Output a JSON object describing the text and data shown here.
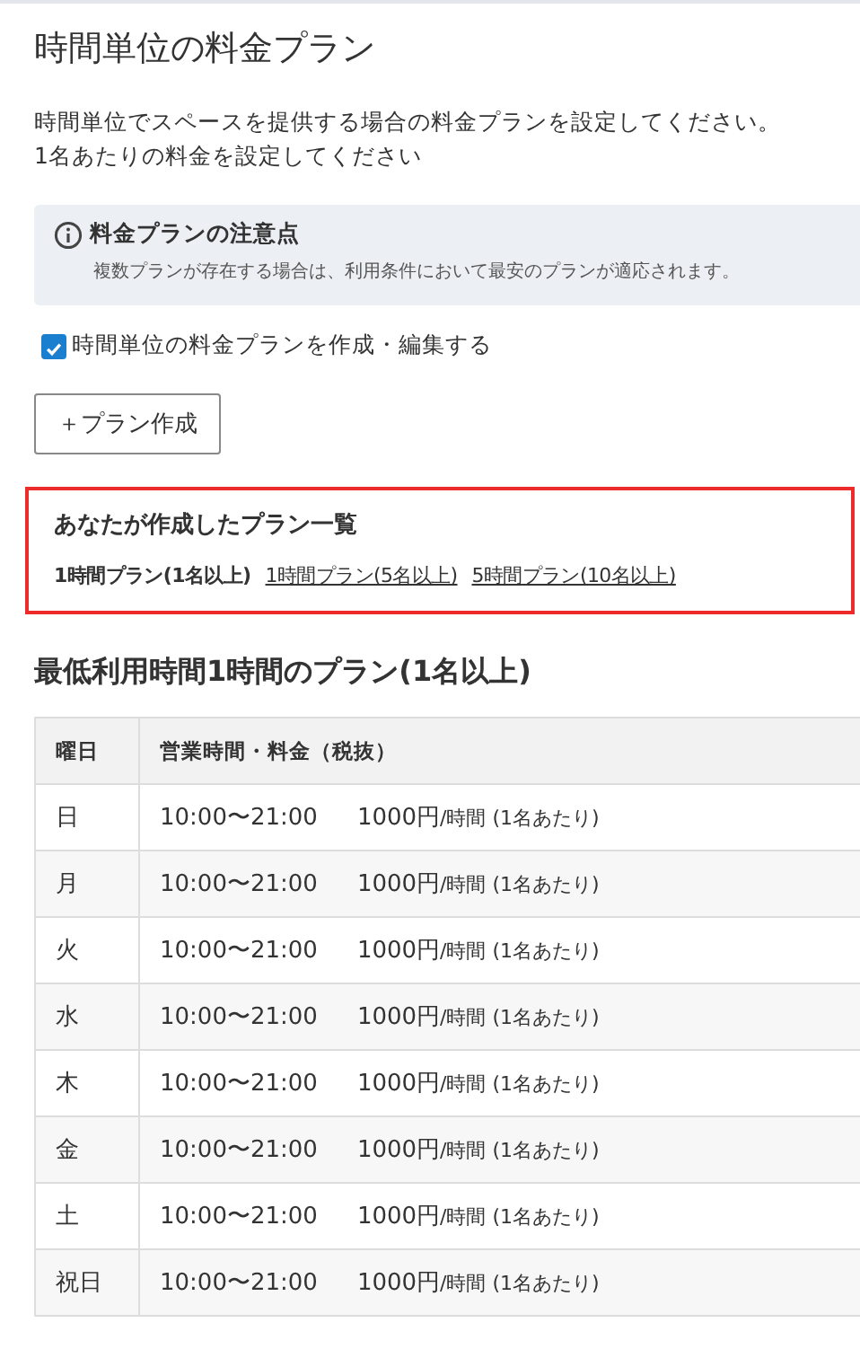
{
  "title": "時間単位の料金プラン",
  "description": [
    "時間単位でスペースを提供する場合の料金プランを設定してください。",
    "1名あたりの料金を設定してください"
  ],
  "notice": {
    "title": "料金プランの注意点",
    "text": "複数プランが存在する場合は、利用条件において最安のプランが適応されます。"
  },
  "checkbox": {
    "label": "時間単位の料金プランを作成・編集する",
    "checked": true
  },
  "create_button": "＋プラン作成",
  "plan_list": {
    "title": "あなたが作成したプラン一覧",
    "plans": [
      {
        "label": "1時間プラン(1名以上)",
        "selected": true
      },
      {
        "label": "1時間プラン(5名以上)",
        "selected": false
      },
      {
        "label": "5時間プラン(10名以上)",
        "selected": false
      }
    ]
  },
  "plan_title": "最低利用時間1時間のプラン(1名以上)",
  "table": {
    "columns": [
      "曜日",
      "営業時間・料金（税抜）"
    ],
    "rows": [
      {
        "day": "日",
        "hours": "10:00〜21:00",
        "price": "1000円",
        "unit": "/時間 (1名あたり)"
      },
      {
        "day": "月",
        "hours": "10:00〜21:00",
        "price": "1000円",
        "unit": "/時間 (1名あたり)"
      },
      {
        "day": "火",
        "hours": "10:00〜21:00",
        "price": "1000円",
        "unit": "/時間 (1名あたり)"
      },
      {
        "day": "水",
        "hours": "10:00〜21:00",
        "price": "1000円",
        "unit": "/時間 (1名あたり)"
      },
      {
        "day": "木",
        "hours": "10:00〜21:00",
        "price": "1000円",
        "unit": "/時間 (1名あたり)"
      },
      {
        "day": "金",
        "hours": "10:00〜21:00",
        "price": "1000円",
        "unit": "/時間 (1名あたり)"
      },
      {
        "day": "土",
        "hours": "10:00〜21:00",
        "price": "1000円",
        "unit": "/時間 (1名あたり)"
      },
      {
        "day": "祝日",
        "hours": "10:00〜21:00",
        "price": "1000円",
        "unit": "/時間 (1名あたり)"
      }
    ]
  }
}
